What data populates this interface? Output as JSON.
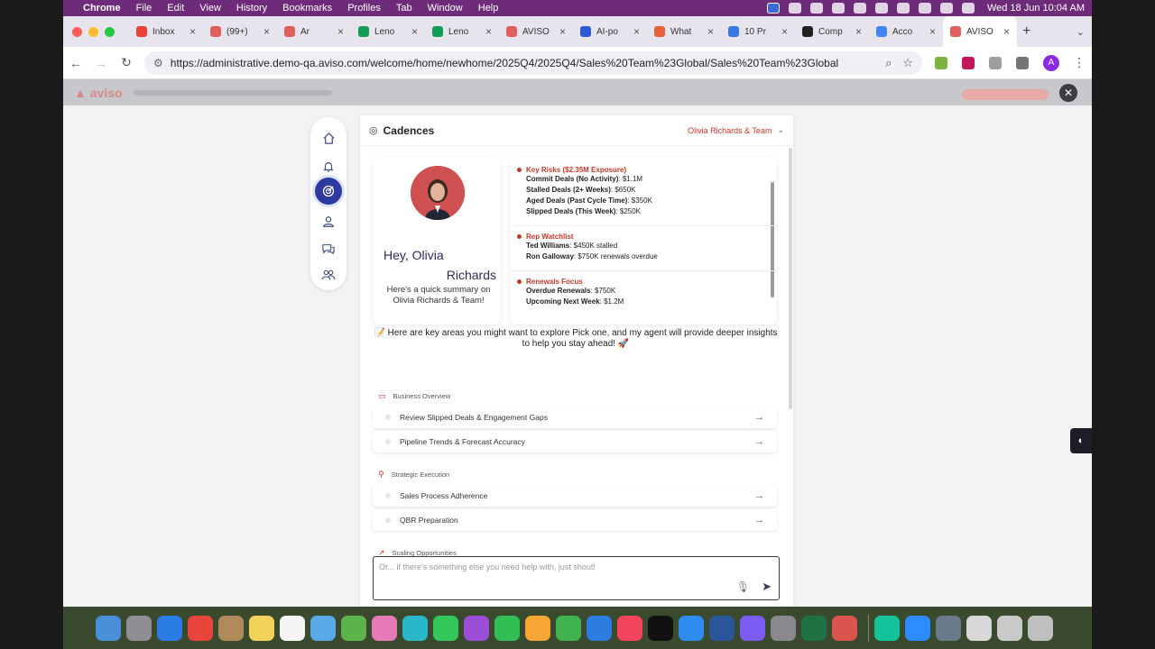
{
  "menubar": {
    "app": "Chrome",
    "items": [
      "File",
      "Edit",
      "View",
      "History",
      "Bookmarks",
      "Profiles",
      "Tab",
      "Window",
      "Help"
    ],
    "clock": "Wed 18 Jun  10:04 AM"
  },
  "tabs": [
    {
      "label": "Inbox",
      "color": "#ea4335"
    },
    {
      "label": "(99+)",
      "color": "#e05f5f"
    },
    {
      "label": "Ar",
      "color": "#e05f5f"
    },
    {
      "label": "Leno",
      "color": "#0f9d58"
    },
    {
      "label": "Leno",
      "color": "#0f9d58"
    },
    {
      "label": "AVISO",
      "color": "#e05f5f"
    },
    {
      "label": "AI-po",
      "color": "#2d5bd6"
    },
    {
      "label": "What",
      "color": "#e8613a"
    },
    {
      "label": "10 Pr",
      "color": "#3b78e7"
    },
    {
      "label": "Comp",
      "color": "#222222"
    },
    {
      "label": "Acco",
      "color": "#4285f4"
    },
    {
      "label": "AVISO",
      "color": "#e05f5f"
    }
  ],
  "active_tab_index": 11,
  "url": "https://administrative.demo-qa.aviso.com/welcome/home/newhome/2025Q4/2025Q4/Sales%20Team%23Global/Sales%20Team%23Global",
  "profile_initial": "A",
  "panel": {
    "title": "Cadences",
    "team_selector": "Olivia Richards & Team"
  },
  "profile": {
    "greeting_line1": "Hey,  Olivia",
    "greeting_line2": "Richards",
    "summary": "Here's a quick summary on Olivia Richards & Team!"
  },
  "insights": [
    {
      "title": "Key Risks ($2.35M Exposure)",
      "lines": [
        {
          "label": "Commit Deals (No Activity)",
          "value": ": $1.1M"
        },
        {
          "label": "Stalled Deals (2+ Weeks)",
          "value": ": $650K"
        },
        {
          "label": "Aged Deals (Past Cycle Time)",
          "value": ": $350K"
        },
        {
          "label": "Slipped Deals (This Week)",
          "value": ": $250K"
        }
      ]
    },
    {
      "title": "Rep Watchlist",
      "lines": [
        {
          "label": "Ted Williams",
          "value": ": $450K stalled"
        },
        {
          "label": "Ron Galloway",
          "value": ": $750K renewals overdue"
        }
      ]
    },
    {
      "title": "Renewals Focus",
      "lines": [
        {
          "label": "Overdue Renewals",
          "value": ": $750K"
        },
        {
          "label": "Upcoming Next Week",
          "value": ": $1.2M"
        }
      ]
    }
  ],
  "intro": "📝 Here are key areas you might want to explore Pick one, and my agent will provide deeper insights to help you stay ahead! 🚀",
  "sections": [
    {
      "label": "Business Overview",
      "options": [
        "Review Slipped Deals & Engagement Gaps",
        "Pipeline Trends & Forecast Accuracy"
      ]
    },
    {
      "label": "Strategic Execution",
      "options": [
        "Sales Process Adherence",
        "QBR Preparation"
      ]
    },
    {
      "label": "Scaling Opportunities",
      "options": []
    }
  ],
  "chat": {
    "placeholder": "Or... if there's something else you need help with, just shout!"
  },
  "colors": {
    "accent": "#c0392b",
    "nav_active": "#2d3aa0",
    "menubar": "#6d2b7a"
  }
}
